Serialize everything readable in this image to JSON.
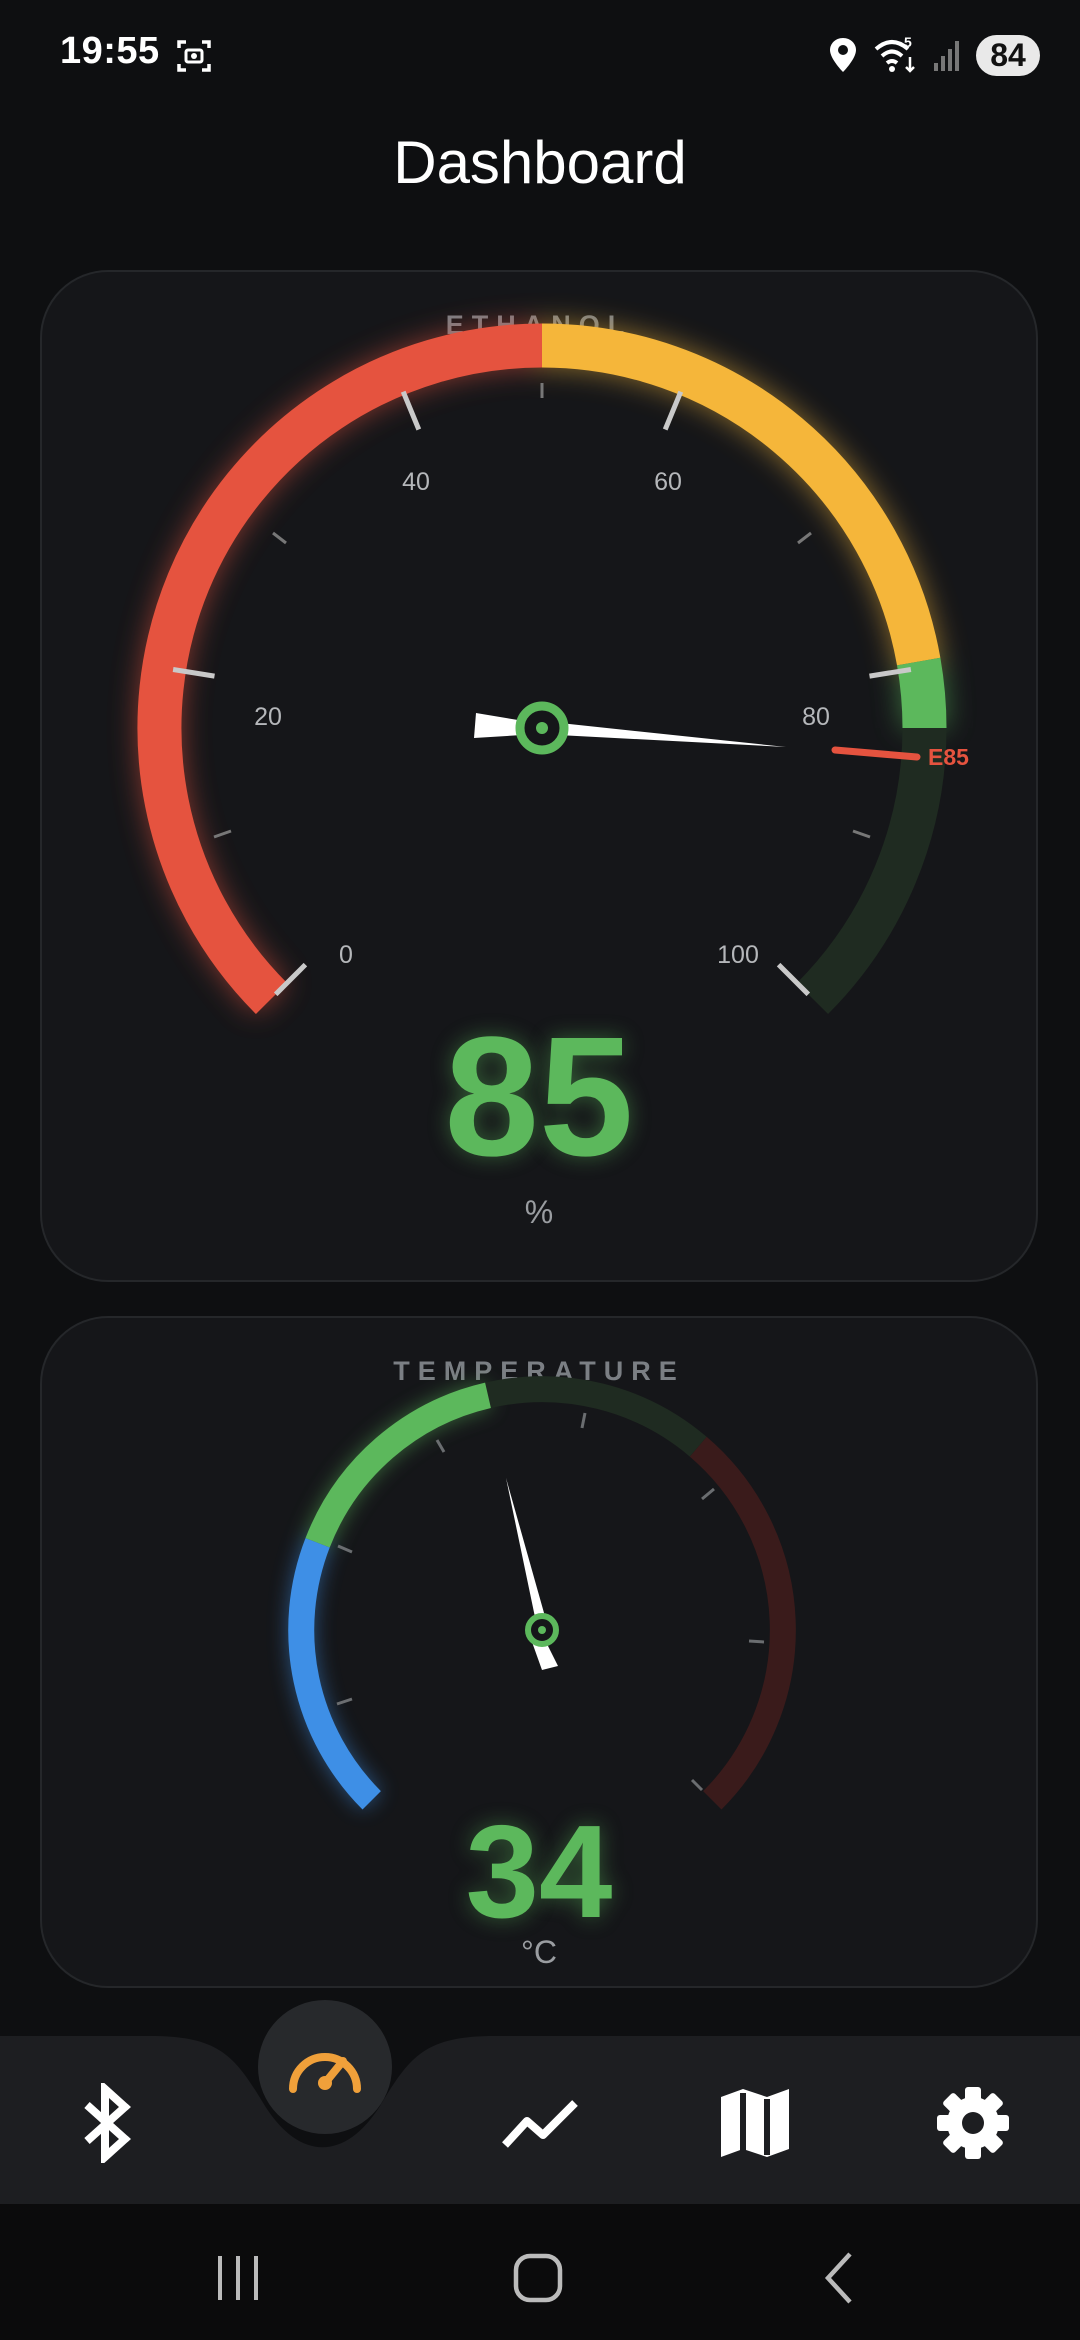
{
  "status_bar": {
    "time": "19:55",
    "battery": "84",
    "network": "5",
    "icons": [
      "screenshot-icon",
      "location-icon",
      "wifi-icon",
      "signal-icon"
    ]
  },
  "page": {
    "title": "Dashboard"
  },
  "ethanol_gauge": {
    "label": "ETHANOL",
    "value": "85",
    "unit": "%",
    "ticks": [
      "0",
      "20",
      "40",
      "60",
      "80",
      "100"
    ],
    "target_marker_label": "E85",
    "colors": {
      "low": "#e5533f",
      "mid": "#f5b63a",
      "good": "#5cb85c",
      "target": "#e5533f"
    }
  },
  "temperature_gauge": {
    "label": "TEMPERATURE",
    "value": "34",
    "unit": "°C",
    "colors": {
      "cold": "#3e8fe6",
      "good": "#5cb85c",
      "hot": "#3a1b1b"
    }
  },
  "bottom_nav": {
    "items": [
      {
        "icon": "bluetooth-icon",
        "active": false
      },
      {
        "icon": "speedometer-icon",
        "active": true
      },
      {
        "icon": "chart-line-icon",
        "active": false
      },
      {
        "icon": "map-icon",
        "active": false
      },
      {
        "icon": "settings-icon",
        "active": false
      }
    ],
    "active_color": "#f0a03a"
  },
  "system_nav": {
    "icons": [
      "recents-icon",
      "home-icon",
      "back-icon"
    ]
  }
}
